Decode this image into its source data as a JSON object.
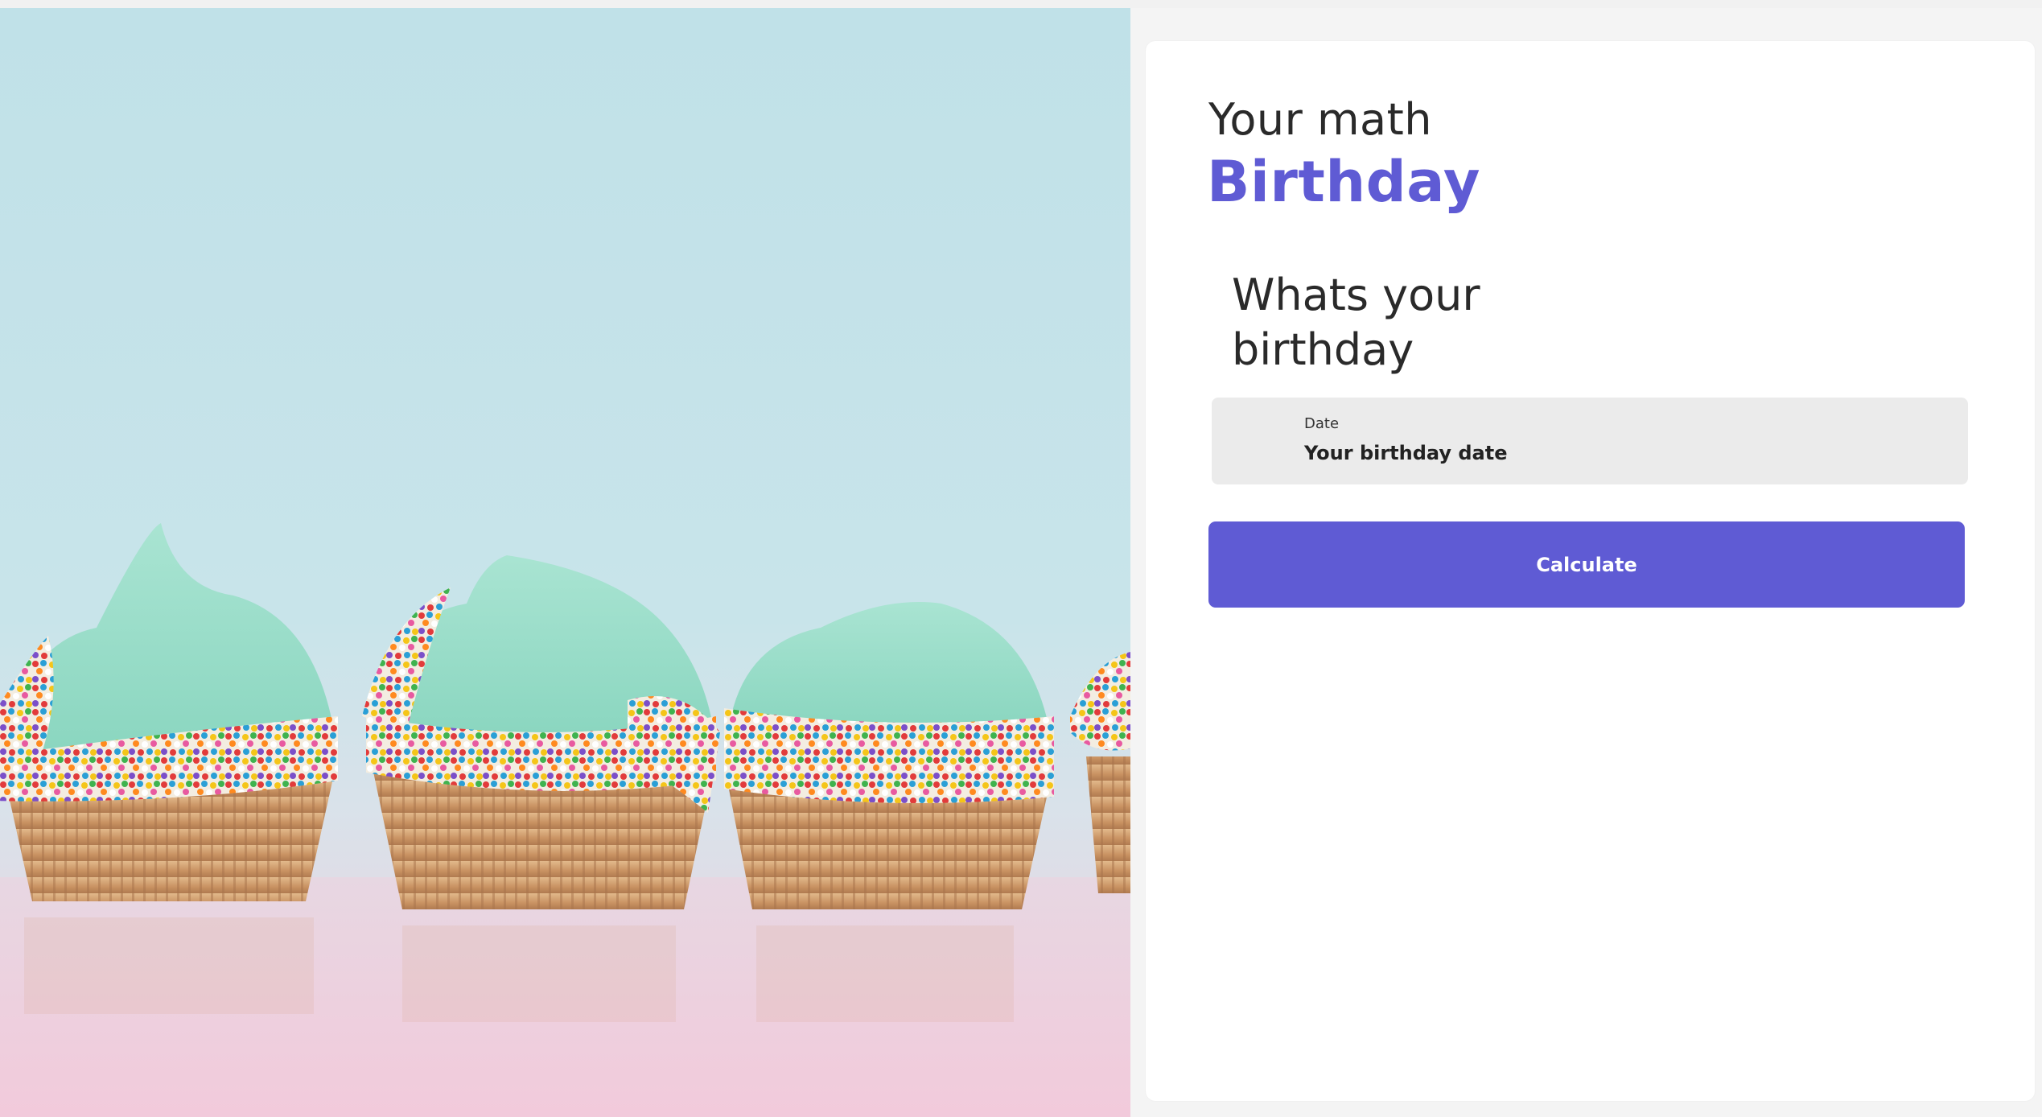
{
  "hero": {
    "image_description": "cupcakes-with-mint-frosting-and-sprinkles"
  },
  "form": {
    "eyebrow": "Your math",
    "headline": "Birthday",
    "question": "Whats your birthday",
    "date_label": "Date",
    "date_placeholder": "Your birthday date",
    "submit_label": "Calculate"
  },
  "colors": {
    "accent": "#5f5bd4",
    "panel_bg": "#ffffff",
    "page_bg": "#f4f4f4",
    "field_bg": "#ebebeb",
    "text": "#2a2a2a"
  }
}
